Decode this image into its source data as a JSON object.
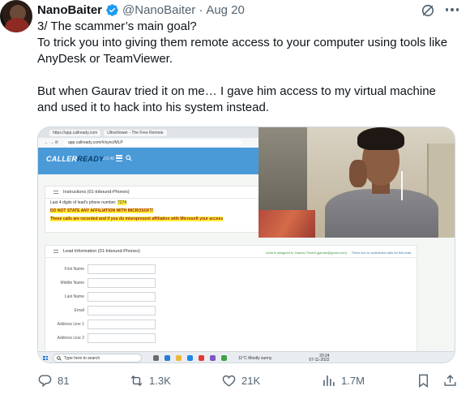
{
  "author": {
    "display_name": "NanoBaiter",
    "handle": "@NanoBaiter",
    "separator": "·",
    "date": "Aug 20"
  },
  "tweet": {
    "line1": "3/ The scammer’s main goal?",
    "line2": "To trick you into giving them remote access to your computer using tools like AnyDesk or TeamViewer.",
    "line3": "But when Gaurav tried it on me… I gave him access to my virtual machine and used it to hack into his system instead."
  },
  "media": {
    "tabs": [
      "https://app.callready.com",
      "UltraViewer - The Free Remote"
    ],
    "url": "app.callready.com/#/sync/MLP",
    "app_logo_a": "CALLER",
    "app_logo_b": "READY",
    "app_version": "2.0.46",
    "instructions_title": "Instructions (01-Inbound-Phones)",
    "lead_digits_label": "Last 4 digits of lead's phone number:",
    "lead_digits_value": "7274",
    "warning_1": "DO NOT STATE ANY AFFILIATION WITH MICROSOFT!",
    "warning_2": "These calls are recorded and if you do misrepresent affiliation with Microsoft your access",
    "lead_title": "Lead Information (01-Inbound-Phones)",
    "lead_assigned": "Lead is assigned to Gaurav Trivedi (gaurav@gcom.com)",
    "lead_noted": "There are no scheduled calls for this lead.",
    "fields": [
      "First Name",
      "Middle Name",
      "Last Name",
      "Email",
      "Address Line 1",
      "Address Line 2"
    ],
    "taskbar_search": "Type here to search",
    "weather": "11°C  Mostly sunny",
    "clock_time": "20:24",
    "clock_date": "07-11-2022"
  },
  "actions": {
    "replies": "81",
    "reposts": "1.3K",
    "likes": "21K",
    "views": "1.7M"
  },
  "colors": {
    "verified": "#1d9bf0",
    "muted": "#536471",
    "app_nav": "#4a9ad8",
    "highlight": "#ffef3a"
  }
}
